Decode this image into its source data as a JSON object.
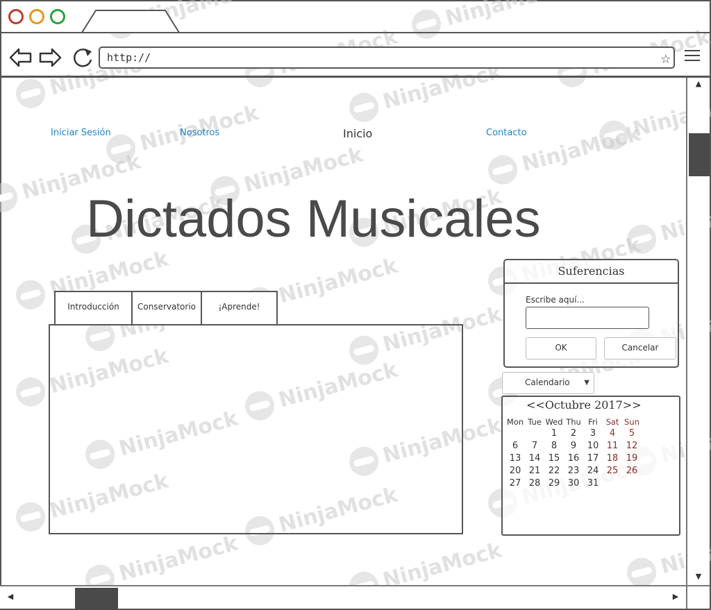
{
  "browser": {
    "url": "http://",
    "icons": {
      "back": "back-arrow-icon",
      "forward": "forward-arrow-icon",
      "reload": "reload-icon",
      "bookmark": "star-icon",
      "menu": "hamburger-menu-icon"
    },
    "window_dots": [
      "#c0392b",
      "#e6951c",
      "#27a23b"
    ]
  },
  "watermark": "NinjaMock",
  "nav": {
    "login": "Iniciar Sesión",
    "about": "Nosotros",
    "home": "Inicio",
    "contact": "Contacto"
  },
  "colors": {
    "link": "#1b84c6",
    "weekend": "#8b2b2b",
    "text": "#333333"
  },
  "main": {
    "title": "Dictados Musicales",
    "tabs": [
      {
        "label": "Introducción"
      },
      {
        "label": "Conservatorio"
      },
      {
        "label": "¡Aprende!"
      }
    ]
  },
  "suggestions": {
    "title": "Suferencias",
    "label": "Escribe aquí...",
    "input_value": "",
    "ok": "OK",
    "cancel": "Cancelar"
  },
  "calendar": {
    "select_value": "Calendario",
    "prev": "<<",
    "month_year": "Octubre 2017",
    "next": ">>",
    "days_of_week": [
      "Mon",
      "Tue",
      "Wed",
      "Thu",
      "Fri",
      "Sat",
      "Sun"
    ],
    "weeks": [
      [
        "",
        "",
        "",
        "",
        "",
        "",
        ""
      ],
      [
        "",
        "",
        "1",
        "2",
        "3",
        "4",
        "5"
      ],
      [
        "6",
        "7",
        "8",
        "9",
        "10",
        "11",
        "12"
      ],
      [
        "13",
        "14",
        "15",
        "16",
        "17",
        "18",
        "19"
      ],
      [
        "20",
        "21",
        "22",
        "23",
        "24",
        "25",
        "26"
      ],
      [
        "27",
        "28",
        "29",
        "30",
        "31",
        "",
        ""
      ]
    ]
  }
}
